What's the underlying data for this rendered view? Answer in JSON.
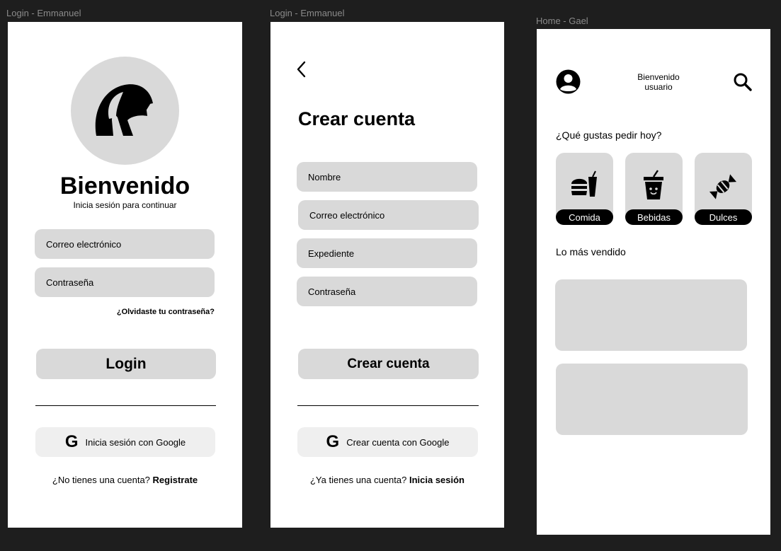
{
  "frames": {
    "login": {
      "label": "Login - Emmanuel",
      "title": "Bienvenido",
      "subtitle": "Inicia sesión para continuar",
      "email_placeholder": "Correo electrónico",
      "password_placeholder": "Contraseña",
      "forgot": "¿Olvidaste tu contraseña?",
      "login_button": "Login",
      "google_button": "Inicia sesión con Google",
      "footer_text": "¿No tienes una cuenta?",
      "footer_link": "Registrate"
    },
    "register": {
      "label": "Login - Emmanuel",
      "back_icon": "chevron-left-icon",
      "title": "Crear cuenta",
      "name_placeholder": "Nombre",
      "email_placeholder": "Correo electrónico",
      "expediente_placeholder": "Expediente",
      "password_placeholder": "Contraseña",
      "create_button": "Crear cuenta",
      "google_button": "Crear cuenta con Google",
      "footer_text": "¿Ya tienes una cuenta?",
      "footer_link": "Inicia sesión"
    },
    "home": {
      "label": "Home - Gael",
      "welcome_line1": "Bienvenido",
      "welcome_line2": "usuario",
      "question": "¿Qué gustas pedir hoy?",
      "categories": [
        {
          "label": "Comida",
          "icon": "burger-drink-icon"
        },
        {
          "label": "Bebidas",
          "icon": "cup-icon"
        },
        {
          "label": "Dulces",
          "icon": "candy-icon"
        }
      ],
      "best_sellers": "Lo más vendido"
    }
  },
  "google_letter": "G"
}
